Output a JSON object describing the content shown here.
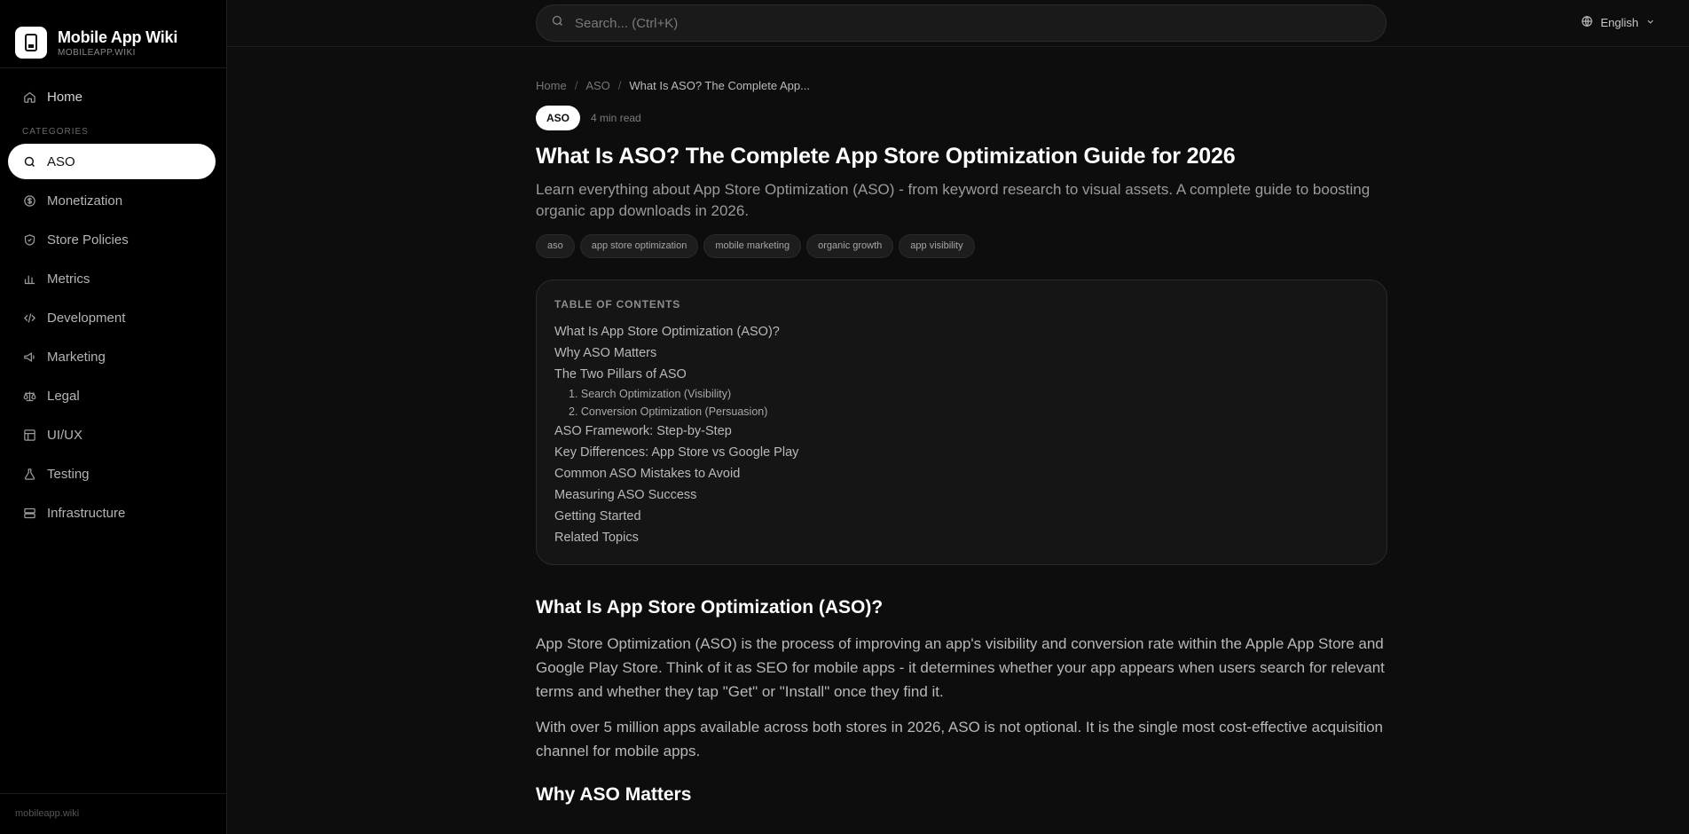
{
  "brand": {
    "name": "Mobile App Wiki",
    "domain": "MOBILEAPP.WIKI"
  },
  "sidebar": {
    "home_label": "Home",
    "categories_label": "CATEGORIES",
    "items": [
      {
        "label": "ASO",
        "icon": "search-icon",
        "active": true
      },
      {
        "label": "Monetization",
        "icon": "dollar-icon"
      },
      {
        "label": "Store Policies",
        "icon": "shield-icon"
      },
      {
        "label": "Metrics",
        "icon": "bar-chart-icon"
      },
      {
        "label": "Development",
        "icon": "code-icon"
      },
      {
        "label": "Marketing",
        "icon": "megaphone-icon"
      },
      {
        "label": "Legal",
        "icon": "scale-icon"
      },
      {
        "label": "UI/UX",
        "icon": "layout-icon"
      },
      {
        "label": "Testing",
        "icon": "flask-icon"
      },
      {
        "label": "Infrastructure",
        "icon": "server-icon"
      }
    ],
    "footer": "mobileapp.wiki"
  },
  "search": {
    "placeholder": "Search... (Ctrl+K)"
  },
  "language": {
    "label": "English"
  },
  "breadcrumb": {
    "home": "Home",
    "category": "ASO",
    "current": "What Is ASO? The Complete App..."
  },
  "article": {
    "badge": "ASO",
    "read_time": "4 min read",
    "title": "What Is ASO? The Complete App Store Optimization Guide for 2026",
    "subtitle": "Learn everything about App Store Optimization (ASO) - from keyword research to visual assets. A complete guide to boosting organic app downloads in 2026.",
    "tags": [
      "aso",
      "app store optimization",
      "mobile marketing",
      "organic growth",
      "app visibility"
    ],
    "toc": {
      "title": "TABLE OF CONTENTS",
      "items": [
        {
          "label": "What Is App Store Optimization (ASO)?"
        },
        {
          "label": "Why ASO Matters"
        },
        {
          "label": "The Two Pillars of ASO"
        },
        {
          "label": "1. Search Optimization (Visibility)",
          "sub": true
        },
        {
          "label": "2. Conversion Optimization (Persuasion)",
          "sub": true
        },
        {
          "label": "ASO Framework: Step-by-Step"
        },
        {
          "label": "Key Differences: App Store vs Google Play"
        },
        {
          "label": "Common ASO Mistakes to Avoid"
        },
        {
          "label": "Measuring ASO Success"
        },
        {
          "label": "Getting Started"
        },
        {
          "label": "Related Topics"
        }
      ]
    },
    "section1": {
      "heading": "What Is App Store Optimization (ASO)?",
      "p1": "App Store Optimization (ASO) is the process of improving an app's visibility and conversion rate within the Apple App Store and Google Play Store. Think of it as SEO for mobile apps - it determines whether your app appears when users search for relevant terms and whether they tap \"Get\" or \"Install\" once they find it.",
      "p2": "With over 5 million apps available across both stores in 2026, ASO is not optional. It is the single most cost-effective acquisition channel for mobile apps."
    },
    "section2": {
      "heading": "Why ASO Matters"
    }
  }
}
